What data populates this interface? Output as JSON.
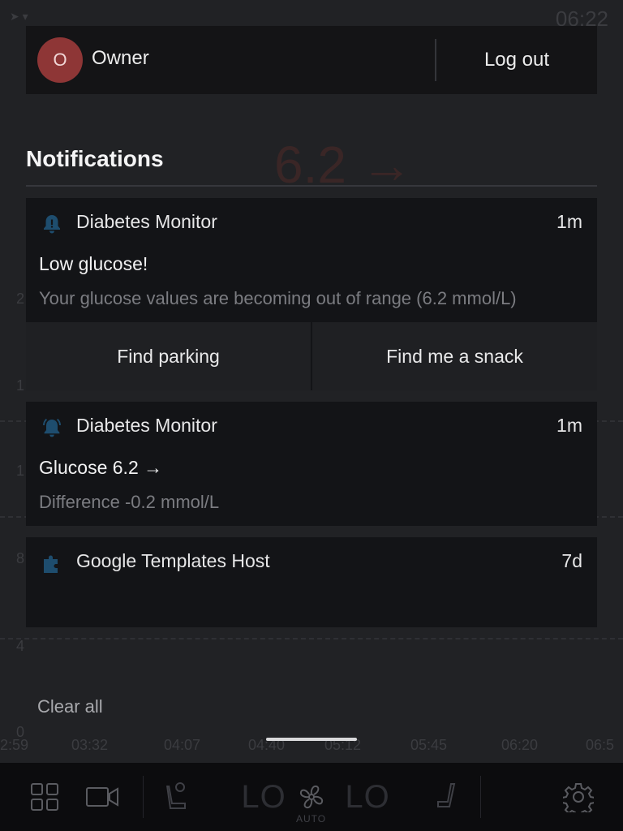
{
  "background_app": {
    "clock": "06:22",
    "reading": "6.2 →",
    "y_ticks": [
      "2",
      "1",
      "1",
      "8",
      "4",
      "0"
    ],
    "x_ticks": [
      "2:59",
      "03:32",
      "04:07",
      "04:40",
      "05:12",
      "05:45",
      "06:20",
      "06:5"
    ]
  },
  "user_card": {
    "avatar_initial": "O",
    "name": "Owner",
    "logout_label": "Log out"
  },
  "notifications": {
    "title": "Notifications",
    "items": [
      {
        "icon": "bell-icon",
        "app": "Diabetes Monitor",
        "time": "1m",
        "headline": "Low glucose!",
        "body": "Your glucose values are becoming out of range (6.2 mmol/L)",
        "actions": [
          "Find parking",
          "Find me a snack"
        ]
      },
      {
        "icon": "bell-ringing-icon",
        "app": "Diabetes Monitor",
        "time": "1m",
        "headline": "Glucose 6.2 →",
        "body": "Difference -0.2 mmol/L"
      },
      {
        "icon": "puzzle-icon",
        "app": "Google Templates Host",
        "time": "7d"
      }
    ],
    "clear_all_label": "Clear all"
  },
  "dock": {
    "left_temp": "LO",
    "right_temp": "LO",
    "fan_mode": "AUTO"
  },
  "colors": {
    "avatar": "#8e3636",
    "icon_accent": "#1e4d6e"
  }
}
